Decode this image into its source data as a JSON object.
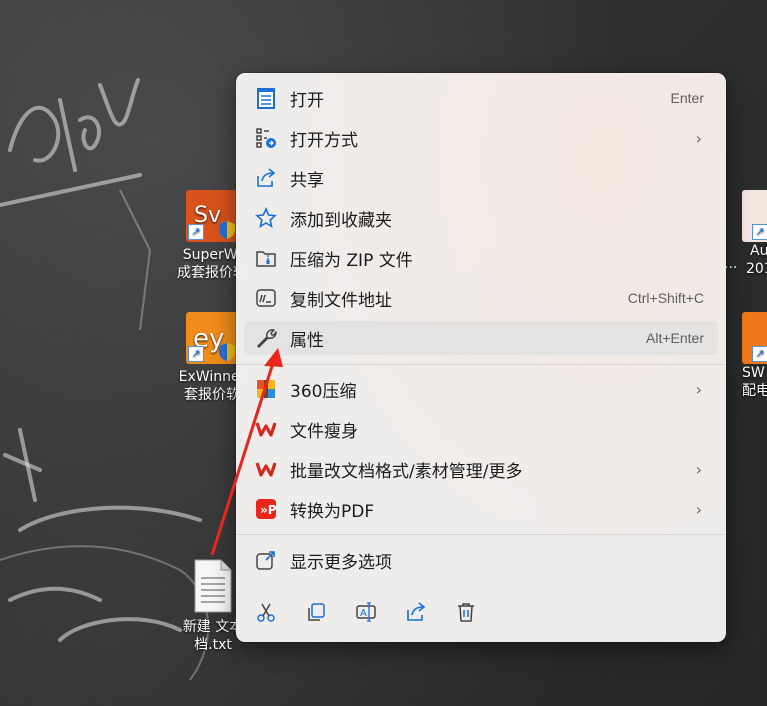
{
  "desktop": {
    "icons": [
      {
        "label1": "SuperWi",
        "label2": "成套报价软"
      },
      {
        "label1": "ExWinner",
        "label2": "套报价软"
      },
      {
        "label1": "新建 文本",
        "label2": "档.txt"
      },
      {
        "label1": "Au",
        "label2": "201"
      },
      {
        "label1": "SW",
        "label2": "配电"
      }
    ],
    "partial_text": "..."
  },
  "context_menu": {
    "items": [
      {
        "label": "打开",
        "shortcut": "Enter",
        "icon": "notepad-icon"
      },
      {
        "label": "打开方式",
        "icon": "open-with-icon",
        "submenu": true
      },
      {
        "label": "共享",
        "icon": "share-icon"
      },
      {
        "label": "添加到收藏夹",
        "icon": "star-icon"
      },
      {
        "label": "压缩为 ZIP 文件",
        "icon": "zip-folder-icon"
      },
      {
        "label": "复制文件地址",
        "shortcut": "Ctrl+Shift+C",
        "icon": "copy-path-icon"
      },
      {
        "label": "属性",
        "shortcut": "Alt+Enter",
        "icon": "wrench-icon",
        "highlighted": true
      },
      {
        "label": "360压缩",
        "icon": "360-zip-icon",
        "submenu": true
      },
      {
        "label": "文件瘦身",
        "icon": "wps-icon"
      },
      {
        "label": "批量改文档格式/素材管理/更多",
        "icon": "wps-icon",
        "submenu": true
      },
      {
        "label": "转换为PDF",
        "icon": "pdf-convert-icon",
        "submenu": true
      },
      {
        "label": "显示更多选项",
        "icon": "more-options-icon"
      }
    ],
    "toolbar": [
      {
        "icon": "cut-icon"
      },
      {
        "icon": "copy-icon"
      },
      {
        "icon": "rename-icon"
      },
      {
        "icon": "share-icon"
      },
      {
        "icon": "delete-icon"
      }
    ],
    "chevron": "›"
  },
  "colors": {
    "accent": "#1a6fd8",
    "wps_red": "#d9261c",
    "arrow": "#e8261c",
    "menu_bg": "#f3f1f0",
    "highlight": "#e5e3e2"
  }
}
